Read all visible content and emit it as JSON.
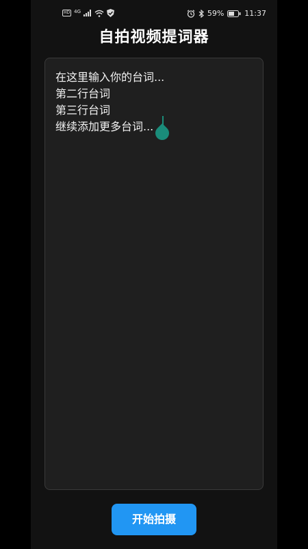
{
  "status_bar": {
    "network_badge": "HD",
    "signal_label": "4G",
    "battery_percent": "59%",
    "time": "11:37"
  },
  "app": {
    "title": "自拍视频提词器"
  },
  "editor": {
    "lines": [
      "在这里输入你的台词...",
      "第二行台词",
      "第三行台词",
      "继续添加更多台词..."
    ]
  },
  "actions": {
    "start_label": "开始拍摄"
  },
  "colors": {
    "accent": "#2196f3",
    "cursor": "#1a8c7a",
    "background": "#121212",
    "editor_bg": "#1f1f1f"
  }
}
